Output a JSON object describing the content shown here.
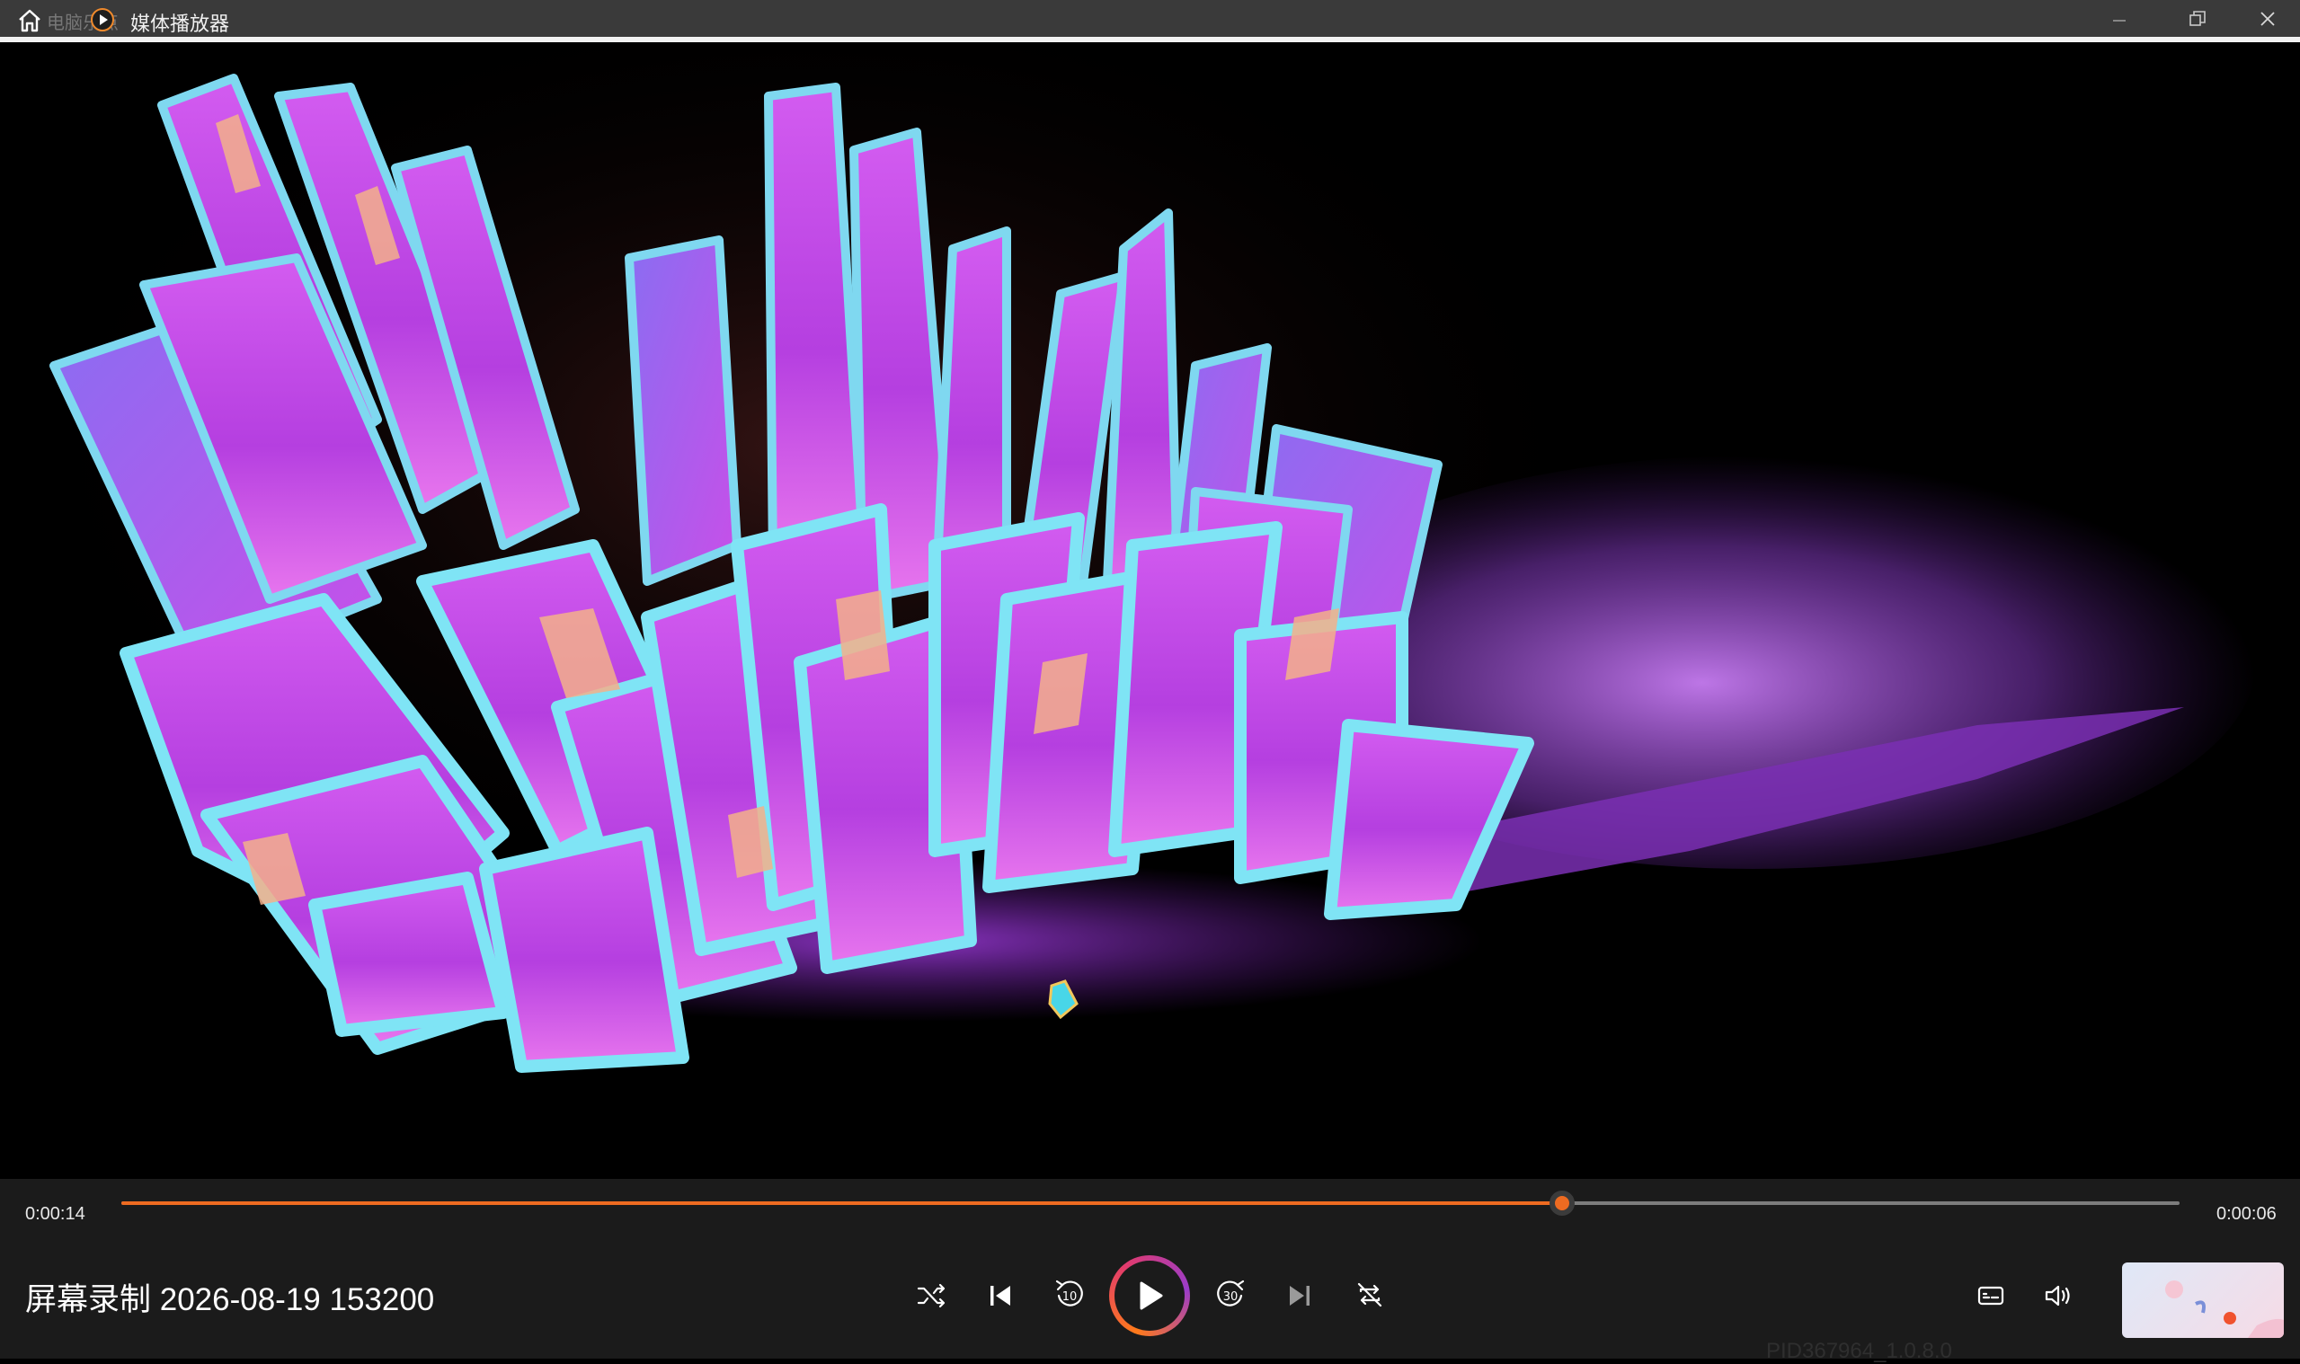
{
  "window": {
    "title": "媒体播放器",
    "ghost_text": "电脑乐点"
  },
  "player": {
    "elapsed": "0:00:14",
    "remaining": "0:00:06",
    "progress": 0.7,
    "media_title": "屏幕录制 2026-08-19 153200",
    "watermark": "PID367964_1.0.8.0"
  },
  "icons": {
    "home": "home-icon",
    "app": "media-player-icon",
    "minimize": "minimize-icon",
    "restore": "restore-icon",
    "close": "close-icon",
    "shuffle": "shuffle-icon",
    "previous": "skip-previous-icon",
    "rewind": "rewind-10-icon",
    "play": "play-icon",
    "forward": "forward-30-icon",
    "next": "skip-next-icon",
    "repeat": "repeat-icon",
    "subtitles": "subtitles-icon",
    "volume": "volume-icon"
  },
  "colors": {
    "accent": "#ee6b21",
    "titlebar": "#3a3a3a",
    "controlbar": "#1b1b1b"
  }
}
